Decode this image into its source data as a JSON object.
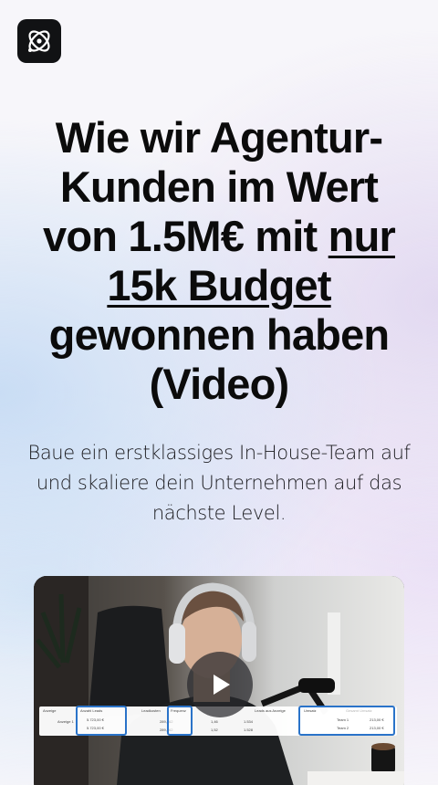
{
  "header": {
    "logo_icon": "atom-logo-icon"
  },
  "hero": {
    "headline_line1": "Wie wir Agentur-",
    "headline_line2": "Kunden im Wert",
    "headline_line3_pre": "von 1.5M€ mit ",
    "headline_line3_underlined": "nur",
    "headline_line4_underlined": "15k Budget",
    "headline_line5": "gewonnen haben",
    "headline_line6": "(Video)",
    "subline": "Baue ein erstklassiges In-House-Team auf und skaliere dein Unternehmen auf das nächste Level."
  },
  "video": {
    "play_icon": "play-icon",
    "overlay_table": {
      "headers": [
        "Anzeige",
        "Anzahl Leads",
        "Leadkosten",
        "Frequenz",
        "Leads aus Anzeige",
        "Umsatz",
        "Gesamt Umsatz"
      ],
      "rows": [
        [
          "Anzeige 1",
          "5.723,00 €",
          "289,462",
          "1,46",
          "1.534",
          "Team 1",
          "213,00 €"
        ],
        [
          "Anzeige 2",
          "5.723,00 €",
          "289,462",
          "1,52",
          "1.528",
          "Team 2",
          "213,00 €"
        ]
      ]
    }
  },
  "colors": {
    "logo_bg": "#111214",
    "highlight_blue": "#2a73c9"
  }
}
